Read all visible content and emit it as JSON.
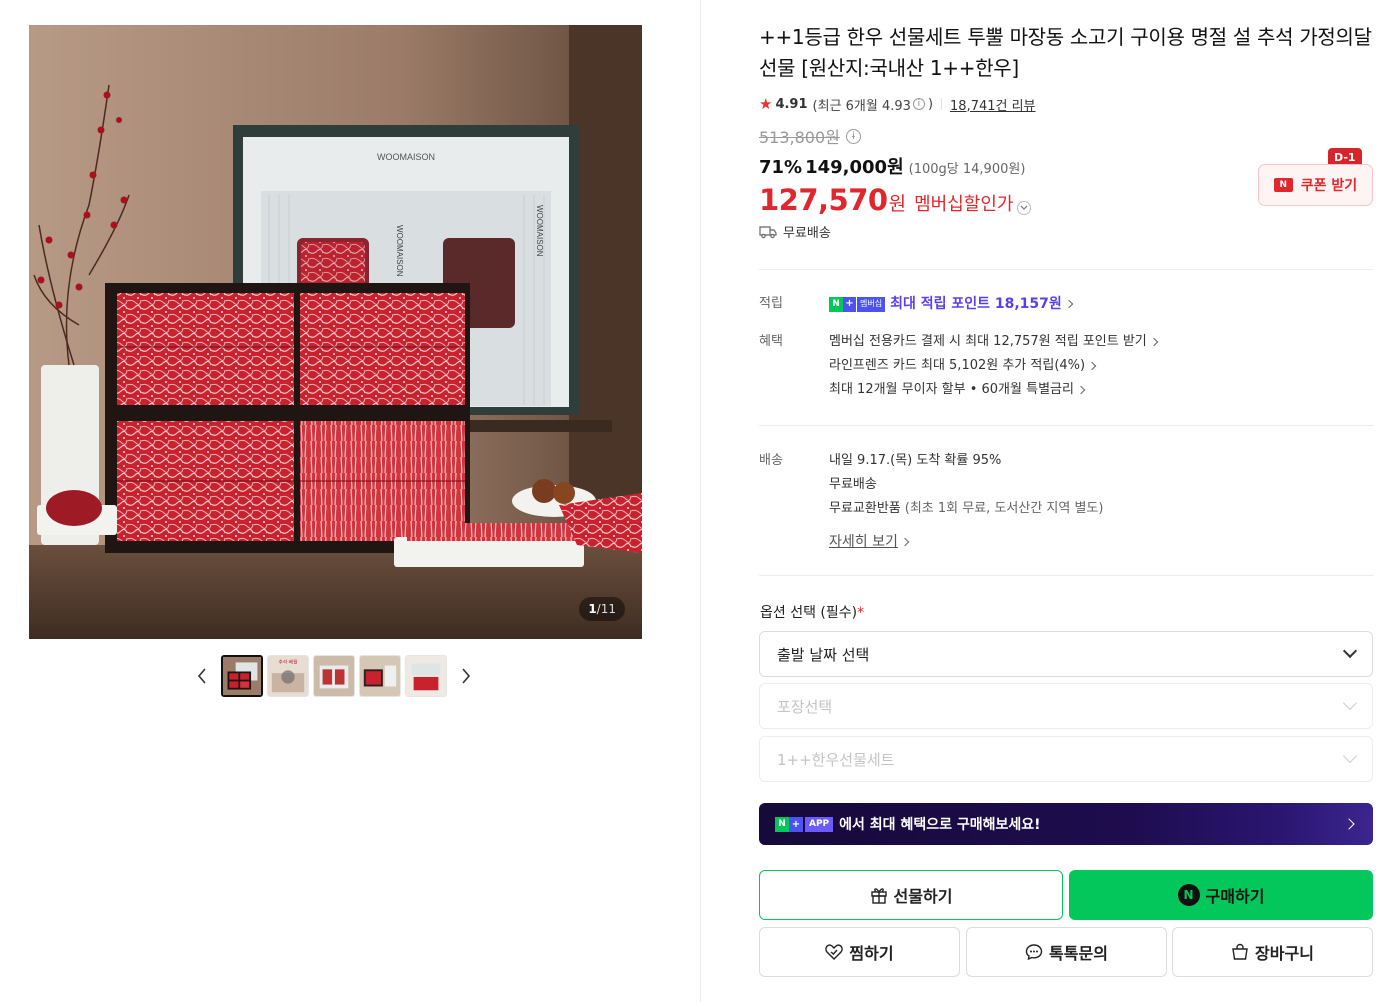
{
  "gallery": {
    "counter_current": "1",
    "counter_sep": "/",
    "counter_total": "11",
    "main_image_text": [
      "WOOMAISON",
      "WOOMAISON",
      "WOOMAISON"
    ],
    "thumbnails": [
      {
        "name": "thumb-1",
        "caption": ""
      },
      {
        "name": "thumb-2",
        "caption": "추석·배월"
      },
      {
        "name": "thumb-3",
        "caption": ""
      },
      {
        "name": "thumb-4",
        "caption": ""
      },
      {
        "name": "thumb-5",
        "caption": ""
      }
    ]
  },
  "product": {
    "title": "++1등급 한우 선물세트 투뿔 마장동 소고기 구이용 명절 설 추석 가정의달 선물 [원산지:국내산 1++한우]",
    "rating": "4.91",
    "recent_rating": "(최근 6개월 4.93",
    "recent_close": ")",
    "review_count": "18,741건 리뷰",
    "original_price": "513,800원",
    "discount_rate": "71%",
    "sale_price": "149,000원",
    "unit_price": "(100g당 14,900원)",
    "member_price": "127,570",
    "member_won": "원",
    "member_label": "멤버십할인가",
    "free_shipping": "무료배송"
  },
  "coupon": {
    "badge": "D-1",
    "logo": "N",
    "label": "쿠폰 받기"
  },
  "points": {
    "label": "적립",
    "badge_n": "N",
    "badge_plus": "+",
    "badge_member": "멤버십",
    "text": "최대 적립 포인트 18,157원"
  },
  "benefits": {
    "label": "혜택",
    "items": [
      "멤버십 전용카드 결제 시 최대 12,757원 적립 포인트 받기",
      "라인프렌즈 카드 최대 5,102원 추가 적립(4%)",
      "최대 12개월 무이자 할부 • 60개월 특별금리"
    ]
  },
  "delivery": {
    "label": "배송",
    "arrival": "내일 9.17.(목) 도착 확률 95%",
    "fee": "무료배송",
    "exchange": "무료교환반품",
    "exchange_note": "(최초 1회 무료, 도서산간 지역 별도)",
    "detail_link": "자세히 보기"
  },
  "options": {
    "title": "옵션 선택 (필수)",
    "required_mark": "*",
    "selects": [
      {
        "label": "출발 날짜 선택",
        "disabled": false
      },
      {
        "label": "포장선택",
        "disabled": true
      },
      {
        "label": "1++한우선물세트",
        "disabled": true
      }
    ]
  },
  "app_banner": {
    "badge_n": "N",
    "badge_plus": "+",
    "badge_app": "APP",
    "text": "에서 최대 혜택으로 구매해보세요!"
  },
  "actions": {
    "gift": "선물하기",
    "buy_logo": "N",
    "buy": "구매하기",
    "wish": "찜하기",
    "talk": "톡톡문의",
    "cart": "장바구니"
  },
  "colors": {
    "accent_red": "#e0272d",
    "naver_green": "#03c75a",
    "point_purple": "#5b3ef0"
  }
}
